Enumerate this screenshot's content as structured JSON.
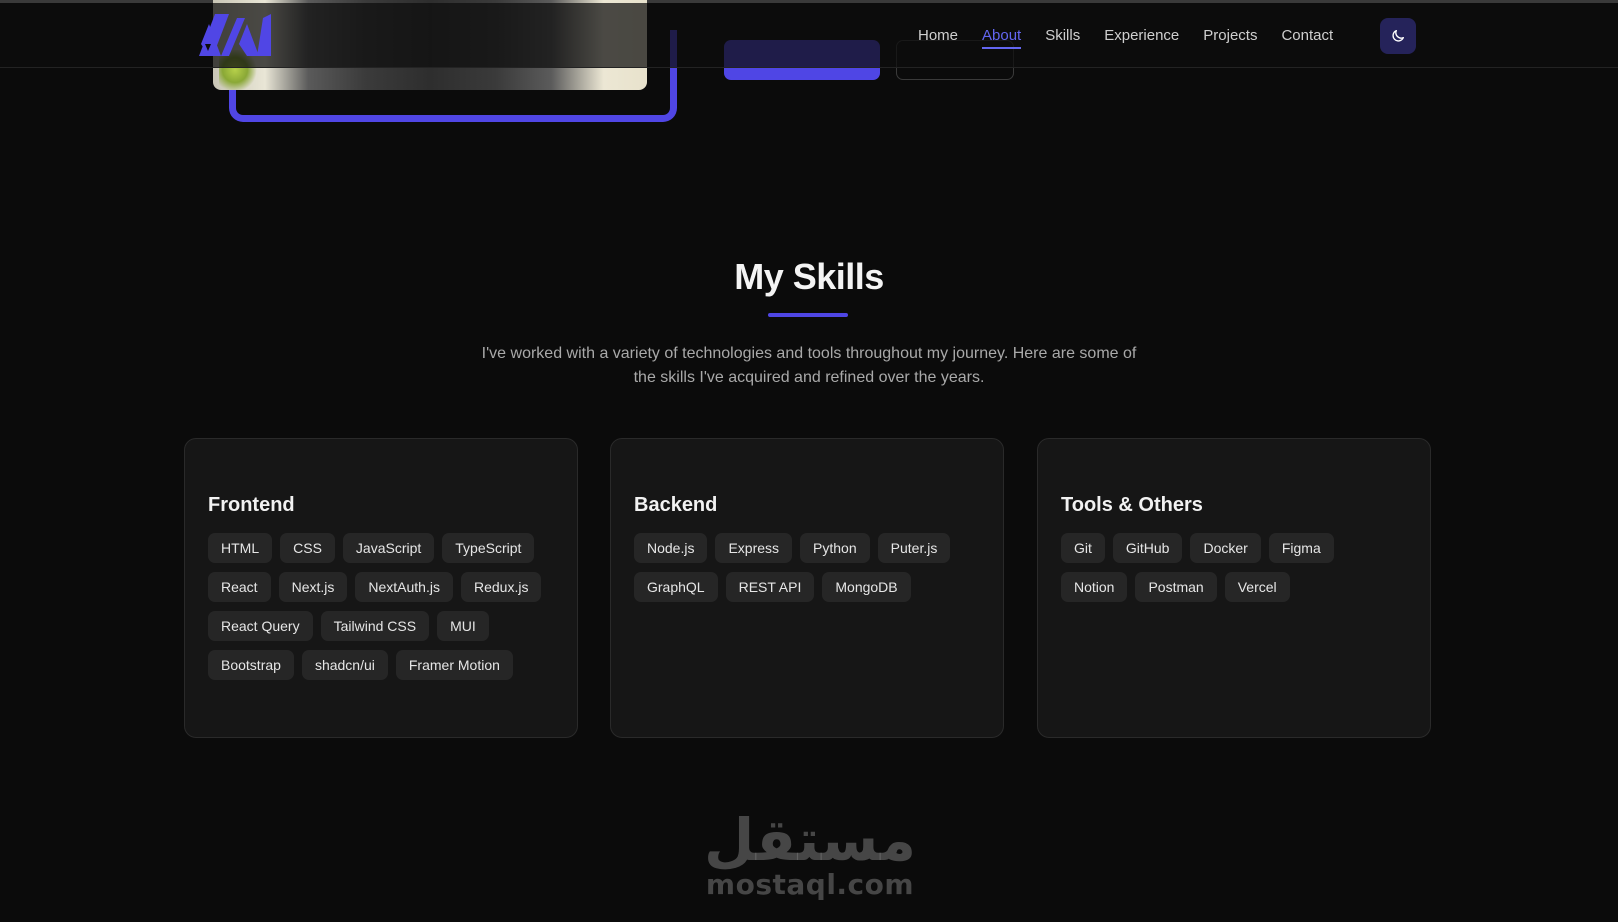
{
  "nav": {
    "links": [
      "Home",
      "About",
      "Skills",
      "Experience",
      "Projects",
      "Contact"
    ],
    "active": "About",
    "theme_toggle_icon": "moon-icon",
    "logo_icon": "logo-mark"
  },
  "colors": {
    "accent": "#4f46e5",
    "background": "#0b0b0b",
    "card": "#161616",
    "tag": "#262626"
  },
  "skills": {
    "title": "My Skills",
    "description": "I've worked with a variety of technologies and tools throughout my journey. Here are some of the skills I've acquired and refined over the years.",
    "categories": [
      {
        "title": "Frontend",
        "items": [
          "HTML",
          "CSS",
          "JavaScript",
          "TypeScript",
          "React",
          "Next.js",
          "NextAuth.js",
          "Redux.js",
          "React Query",
          "Tailwind CSS",
          "MUI",
          "Bootstrap",
          "shadcn/ui",
          "Framer Motion"
        ]
      },
      {
        "title": "Backend",
        "items": [
          "Node.js",
          "Express",
          "Python",
          "Puter.js",
          "GraphQL",
          "REST API",
          "MongoDB"
        ]
      },
      {
        "title": "Tools & Others",
        "items": [
          "Git",
          "GitHub",
          "Docker",
          "Figma",
          "Notion",
          "Postman",
          "Vercel"
        ]
      }
    ]
  },
  "watermark": {
    "arabic": "مستقل",
    "latin": "mostaql.com"
  }
}
